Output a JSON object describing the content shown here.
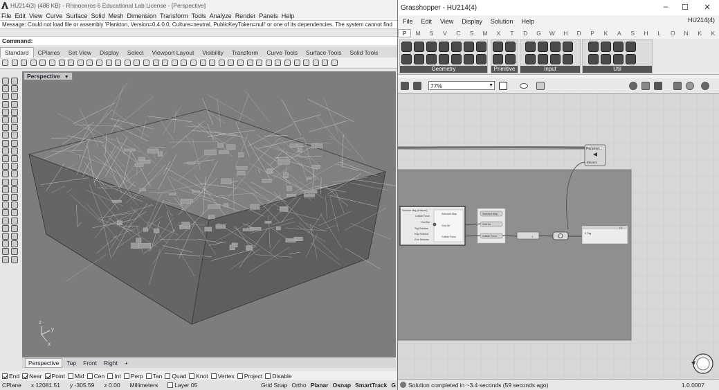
{
  "rhino": {
    "title": "HU214(3) (488 KB) - Rhinoceros 6 Educational Lab License - [Perspective]",
    "menu": [
      "File",
      "Edit",
      "View",
      "Curve",
      "Surface",
      "Solid",
      "Mesh",
      "Dimension",
      "Transform",
      "Tools",
      "Analyze",
      "Render",
      "Panels",
      "Help"
    ],
    "message": "Message: Could not load file or assembly 'Plankton, Version=0.4.0.0, Culture=neutral, PublicKeyToken=null' or one of its dependencies. The system cannot find",
    "command_label": "Command:",
    "tabs": [
      "Standard",
      "CPlanes",
      "Set View",
      "Display",
      "Select",
      "Viewport Layout",
      "Visibility",
      "Transform",
      "Curve Tools",
      "Surface Tools",
      "Solid Tools"
    ],
    "viewport_label": "Perspective",
    "view_tabs": [
      "Perspective",
      "Top",
      "Front",
      "Right"
    ],
    "add_tab": "+",
    "snaps": [
      {
        "label": "End",
        "on": true
      },
      {
        "label": "Near",
        "on": true
      },
      {
        "label": "Point",
        "on": true
      },
      {
        "label": "Mid",
        "on": false
      },
      {
        "label": "Cen",
        "on": false
      },
      {
        "label": "Int",
        "on": false
      },
      {
        "label": "Perp",
        "on": false
      },
      {
        "label": "Tan",
        "on": false
      },
      {
        "label": "Quad",
        "on": false
      },
      {
        "label": "Knot",
        "on": false
      },
      {
        "label": "Vertex",
        "on": false
      },
      {
        "label": "Project",
        "on": false
      },
      {
        "label": "Disable",
        "on": false
      }
    ],
    "status": {
      "cplane": "CPlane",
      "x": "x 12081.51",
      "y": "y -305.59",
      "z": "z 0.00",
      "units": "Millimeters",
      "layer": "Layer 05",
      "grid_snap": "Grid Snap",
      "ortho": "Ortho",
      "planar": "Planar",
      "osnap": "Osnap",
      "smarttrack": "SmartTrack",
      "gumball": "G"
    },
    "axes": {
      "z": "z",
      "y": "y",
      "x": "x"
    }
  },
  "gh": {
    "title": "Grasshopper - HU214(4)",
    "window_controls": [
      "–",
      "☐",
      "✕"
    ],
    "menu": [
      "File",
      "Edit",
      "View",
      "Display",
      "Solution",
      "Help"
    ],
    "doc_name": "HU214(4)",
    "tabs": [
      "P",
      "M",
      "S",
      "V",
      "C",
      "S",
      "M",
      "X",
      "T",
      "D",
      "G",
      "W",
      "H",
      "D",
      "P",
      "K",
      "A",
      "S",
      "H",
      "L",
      "O",
      "N",
      "K",
      "K"
    ],
    "groups": [
      "Geometry",
      "Primitive",
      "Input",
      "Util"
    ],
    "zoom": "77%",
    "nodes": {
      "param": "Paramet...",
      "param_sub": "Elevers",
      "cluster_inputs": [
        "Solution Map (Kalman)",
        "Collide Force",
        "Grid Sel",
        "Trig Solution",
        "Ray Selector",
        "Grid Selector"
      ],
      "cluster_outputs": [
        "Selected Map",
        "Grid Srf",
        "Collide Force"
      ],
      "panel_items": [
        "Selected Map",
        "Grid Srf",
        "Collide Force"
      ],
      "slider_value": "1",
      "out_label": "0  Tag",
      "out_index": "(1)"
    },
    "status": "Solution completed in ~3.4 seconds (59 seconds ago)",
    "version": "1.0.0007"
  }
}
